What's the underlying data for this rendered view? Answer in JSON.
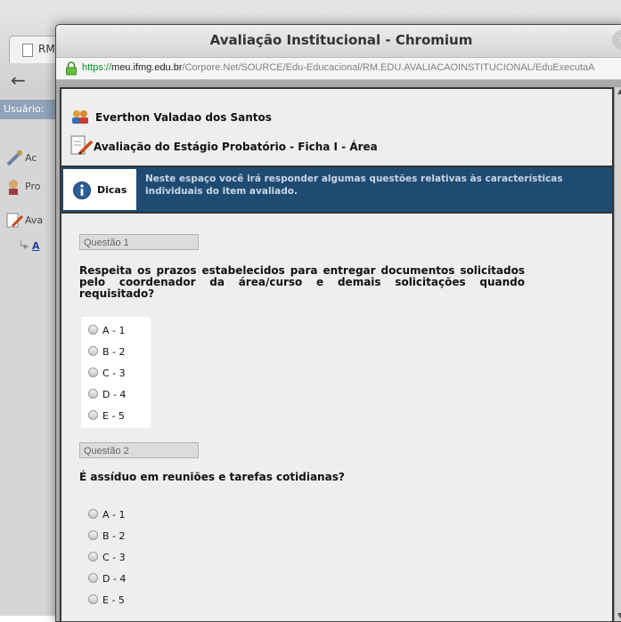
{
  "background_window": {
    "tab_label": "RM",
    "user_label": "Usuário:",
    "menu": [
      "Ac",
      "Pro",
      "Ava"
    ],
    "sub_item": "A"
  },
  "popup": {
    "title": "Avaliação Institucional - Chromium",
    "close_icon": "×",
    "url": {
      "scheme": "https://",
      "host": "meu.ifmg.edu.br",
      "path": "/Corpore.Net/SOURCE/Edu-Educacional/RM.EDU.AVALIACAOINSTITUCIONAL/EduExecutaA"
    }
  },
  "page": {
    "user_name": "Everthon Valadao dos Santos",
    "evaluation_title": "Avaliação do Estágio Probatório - Ficha I - Área",
    "tips": {
      "label": "Dicas",
      "text": "Neste espaço você irá responder algumas questões relativas às características individuais do item avaliado."
    },
    "questions": [
      {
        "number": "Questão 1",
        "text": "Respeita os prazos estabelecidos para entregar documentos solicitados pelo coordenador da área/curso e demais solicitações quando requisitado?",
        "options": [
          "A - 1",
          "B - 2",
          "C - 3",
          "D - 4",
          "E - 5"
        ]
      },
      {
        "number": "Questão 2",
        "text": "É assíduo em reuniões e tarefas cotidianas?",
        "options": [
          "A - 1",
          "B - 2",
          "C - 3",
          "D - 4",
          "E - 5"
        ]
      }
    ]
  },
  "colors": {
    "tips_background": "#1f4b73",
    "url_scheme": "#0b8a24"
  }
}
